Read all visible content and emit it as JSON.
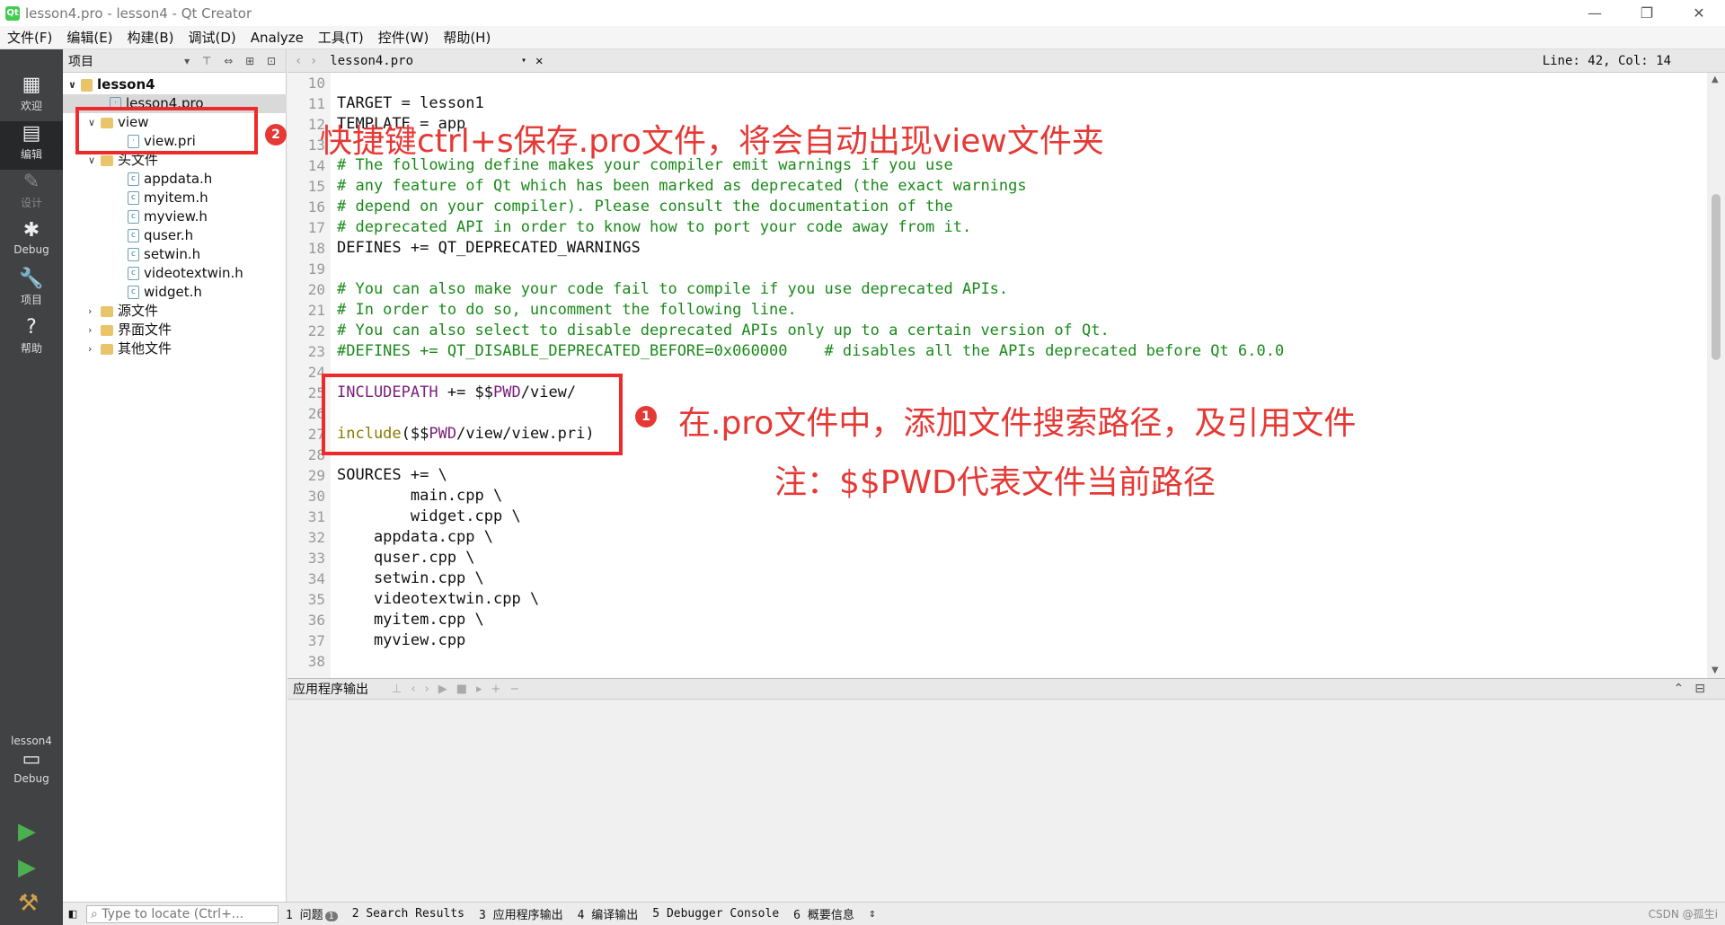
{
  "window": {
    "title": "lesson4.pro - lesson4 - Qt Creator",
    "minimize": "—",
    "restore": "❐",
    "close": "✕"
  },
  "menu": [
    "文件(F)",
    "编辑(E)",
    "构建(B)",
    "调试(D)",
    "Analyze",
    "工具(T)",
    "控件(W)",
    "帮助(H)"
  ],
  "modes": [
    {
      "label": "欢迎",
      "icon": "grid-icon"
    },
    {
      "label": "编辑",
      "icon": "edit-icon"
    },
    {
      "label": "设计",
      "icon": "pencil-icon"
    },
    {
      "label": "Debug",
      "icon": "bug-icon"
    },
    {
      "label": "项目",
      "icon": "wrench-icon"
    },
    {
      "label": "帮助",
      "icon": "help-icon"
    }
  ],
  "kit": {
    "project": "lesson4",
    "config": "Debug"
  },
  "sidebar": {
    "title": "项目",
    "tree": {
      "root": "lesson4",
      "pro_file": "lesson4.pro",
      "view_folder": "view",
      "view_file": "view.pri",
      "headers_folder": "头文件",
      "headers": [
        "appdata.h",
        "myitem.h",
        "myview.h",
        "quser.h",
        "setwin.h",
        "videotextwin.h",
        "widget.h"
      ],
      "sources_folder": "源文件",
      "forms_folder": "界面文件",
      "other_folder": "其他文件"
    }
  },
  "editor": {
    "file_tab": "lesson4.pro",
    "position": "Line: 42, Col: 14",
    "line_numbers": [
      "10",
      "11",
      "12",
      "13",
      "14",
      "15",
      "16",
      "17",
      "18",
      "19",
      "20",
      "21",
      "22",
      "23",
      "24",
      "25",
      "26",
      "27",
      "28",
      "29",
      "30",
      "31",
      "32",
      "33",
      "34",
      "35",
      "36",
      "37",
      "38"
    ],
    "lines": {
      "l11": "TARGET = lesson1",
      "l12": "TEMPLATE = app",
      "l14": "# The following define makes your compiler emit warnings if you use",
      "l15": "# any feature of Qt which has been marked as deprecated (the exact warnings",
      "l16": "# depend on your compiler). Please consult the documentation of the",
      "l17": "# deprecated API in order to know how to port your code away from it.",
      "l18": "DEFINES += QT_DEPRECATED_WARNINGS",
      "l20": "# You can also make your code fail to compile if you use deprecated APIs.",
      "l21": "# In order to do so, uncomment the following line.",
      "l22": "# You can also select to disable deprecated APIs only up to a certain version of Qt.",
      "l23": "#DEFINES += QT_DISABLE_DEPRECATED_BEFORE=0x060000    # disables all the APIs deprecated before Qt 6.0.0",
      "l25_kw": "INCLUDEPATH",
      "l25_rest": " += $$",
      "l25_pwd": "PWD",
      "l25_tail": "/view/",
      "l27_fn": "include",
      "l27_a": "($$",
      "l27_pwd": "PWD",
      "l27_b": "/view/view.pri)",
      "l29": "SOURCES += \\",
      "l30": "        main.cpp \\",
      "l31": "        widget.cpp \\",
      "l32": "    appdata.cpp \\",
      "l33": "    quser.cpp \\",
      "l34": "    setwin.cpp \\",
      "l35": "    videotextwin.cpp \\",
      "l36": "    myitem.cpp \\",
      "l37": "    myview.cpp"
    }
  },
  "output": {
    "title": "应用程序输出"
  },
  "statusbar": {
    "locate_placeholder": "Type to locate (Ctrl+...",
    "tabs": [
      {
        "num": "1",
        "label": "问题",
        "badge": "1"
      },
      {
        "num": "2",
        "label": "Search Results"
      },
      {
        "num": "3",
        "label": "应用程序输出"
      },
      {
        "num": "4",
        "label": "编译输出"
      },
      {
        "num": "5",
        "label": "Debugger Console"
      },
      {
        "num": "6",
        "label": "概要信息"
      }
    ],
    "watermark": "CSDN @孤生i"
  },
  "annotations": {
    "a1_num": "1",
    "a1_text": "在.pro文件中，添加文件搜索路径，及引用文件",
    "a1_note": "注：$$PWD代表文件当前路径",
    "a2_num": "2",
    "a2_text": "快捷键ctrl+s保存.pro文件，将会自动出现view文件夹"
  },
  "colors": {
    "annotation": "#e53935",
    "comment": "#1a8a1a",
    "keyword": "#7a1e7a",
    "modebar": "#404244"
  }
}
